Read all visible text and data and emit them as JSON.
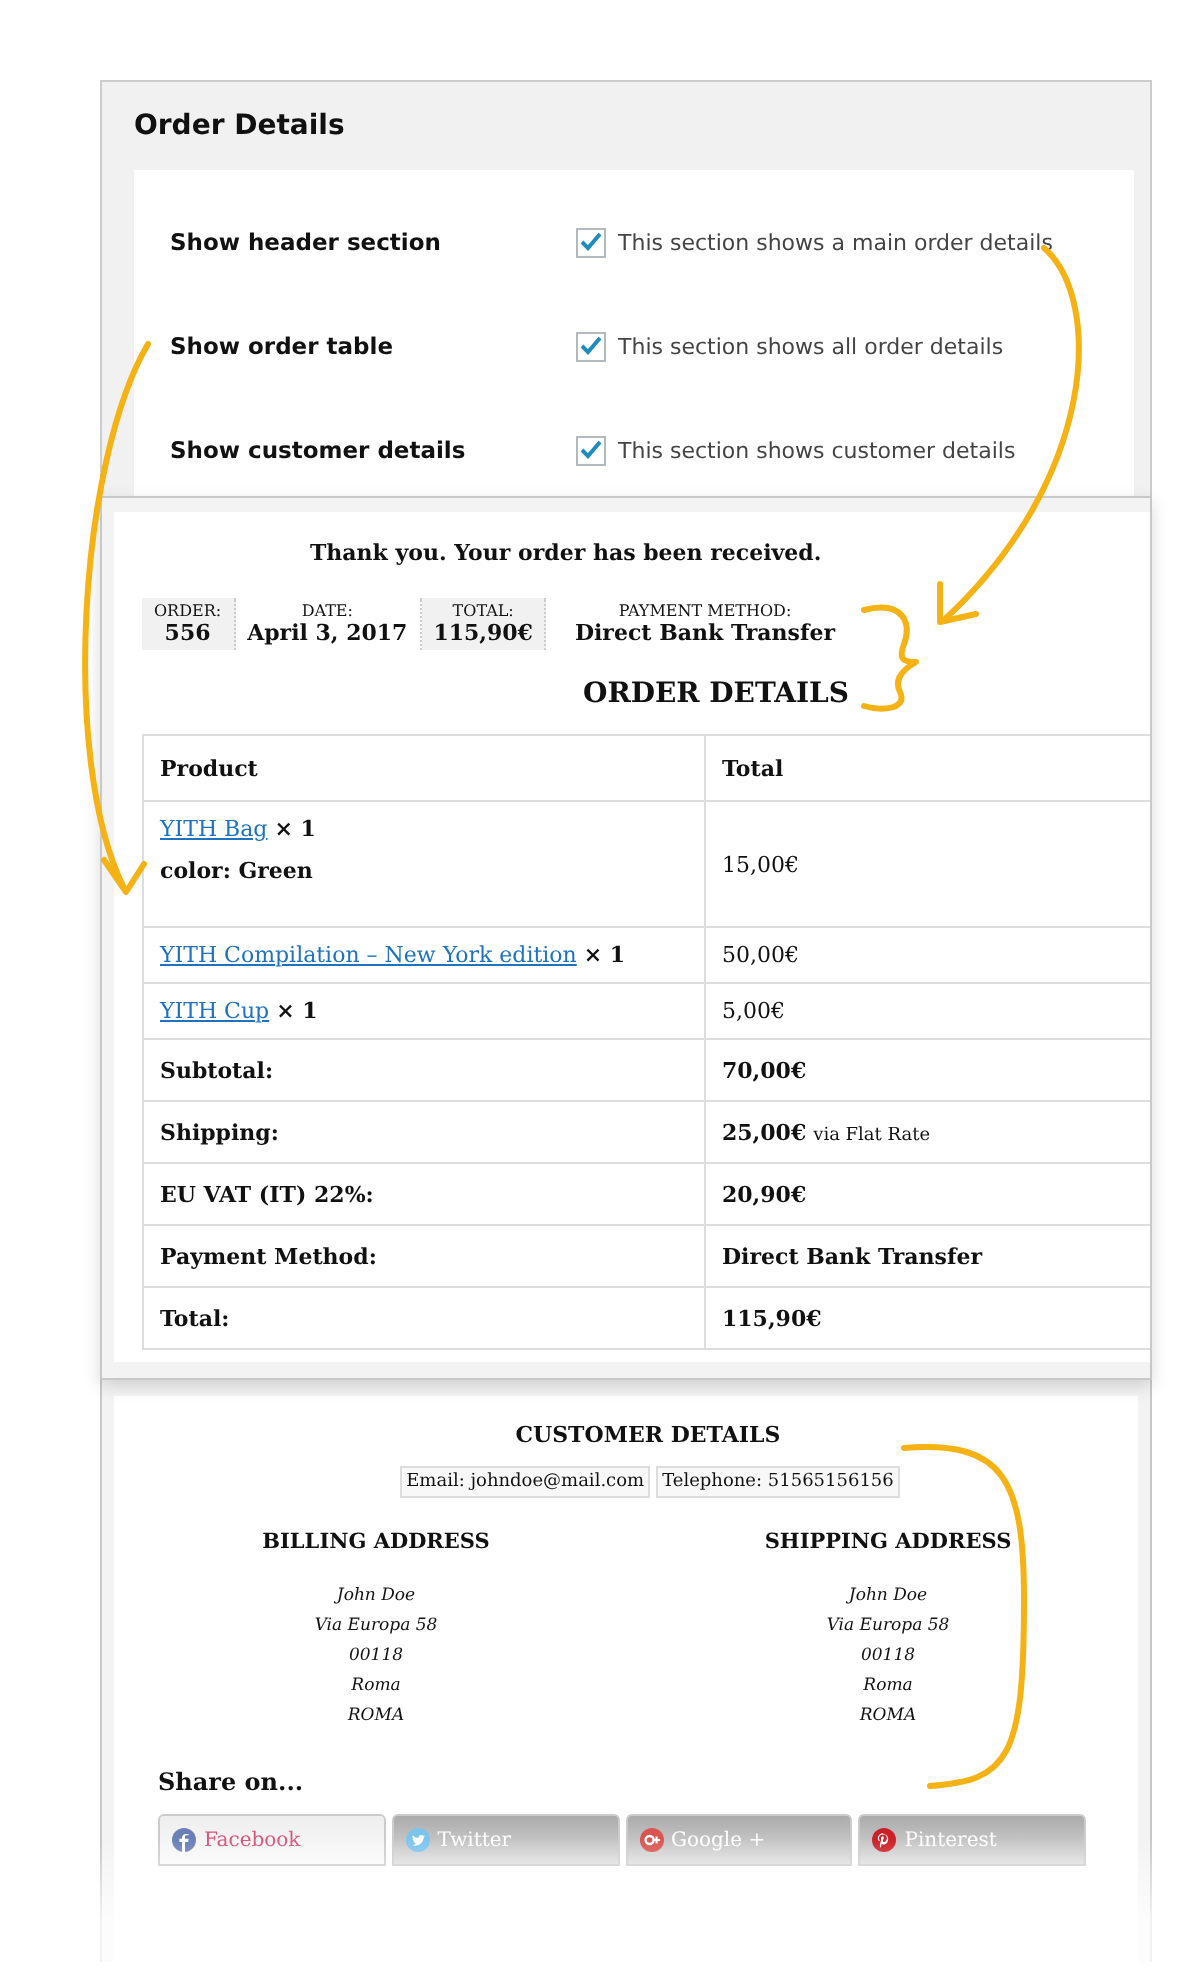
{
  "settings": {
    "title": "Order Details",
    "rows": [
      {
        "label": "Show header section",
        "checked": true,
        "description": "This section shows a main order details"
      },
      {
        "label": "Show order table",
        "checked": true,
        "description": "This section shows all order details"
      },
      {
        "label": "Show customer details",
        "checked": true,
        "description": "This section shows customer details"
      }
    ]
  },
  "order": {
    "thanks": "Thank you. Your order has been received.",
    "meta": [
      {
        "label": "ORDER:",
        "value": "556",
        "highlighted": true
      },
      {
        "label": "DATE:",
        "value": "April 3, 2017",
        "highlighted": false
      },
      {
        "label": "TOTAL:",
        "value": "115,90€",
        "highlighted": true
      },
      {
        "label": "PAYMENT METHOD:",
        "value": "Direct Bank Transfer",
        "highlighted": false
      }
    ],
    "title": "ORDER DETAILS",
    "columns": [
      "Product",
      "Total"
    ],
    "items": [
      {
        "product": "YITH Bag",
        "quantity": "× 1",
        "variation": "color: Green",
        "total": "15,00€"
      },
      {
        "product": "YITH Compilation – New York edition",
        "quantity": "× 1",
        "total": "50,00€"
      },
      {
        "product": "YITH Cup",
        "quantity": "× 1",
        "total": "5,00€"
      }
    ],
    "totals": [
      {
        "label": "Subtotal:",
        "value": "70,00€"
      },
      {
        "label": "Shipping:",
        "value": "25,00€",
        "note": "via Flat Rate"
      },
      {
        "label": "EU VAT (IT) 22%:",
        "value": "20,90€"
      },
      {
        "label": "Payment Method:",
        "value": "Direct Bank Transfer"
      },
      {
        "label": "Total:",
        "value": "115,90€"
      }
    ]
  },
  "customer": {
    "title": "CUSTOMER DETAILS",
    "contacts": [
      {
        "label": "Email:",
        "value": "johndoe@mail.com"
      },
      {
        "label": "Telephone:",
        "value": "51565156156"
      }
    ],
    "addresses": [
      {
        "title": "BILLING ADDRESS",
        "lines": [
          "John Doe",
          "Via Europa 58",
          "00118",
          "Roma",
          "ROMA"
        ]
      },
      {
        "title": "SHIPPING ADDRESS",
        "lines": [
          "John Doe",
          "Via Europa 58",
          "00118",
          "Roma",
          "ROMA"
        ]
      }
    ],
    "share_title": "Share on...",
    "share": [
      {
        "kind": "facebook",
        "label": "Facebook",
        "selected": true
      },
      {
        "kind": "twitter",
        "label": "Twitter",
        "selected": false
      },
      {
        "kind": "google",
        "label": "Google +",
        "selected": false
      },
      {
        "kind": "pinterest",
        "label": "Pinterest",
        "selected": false
      }
    ]
  }
}
